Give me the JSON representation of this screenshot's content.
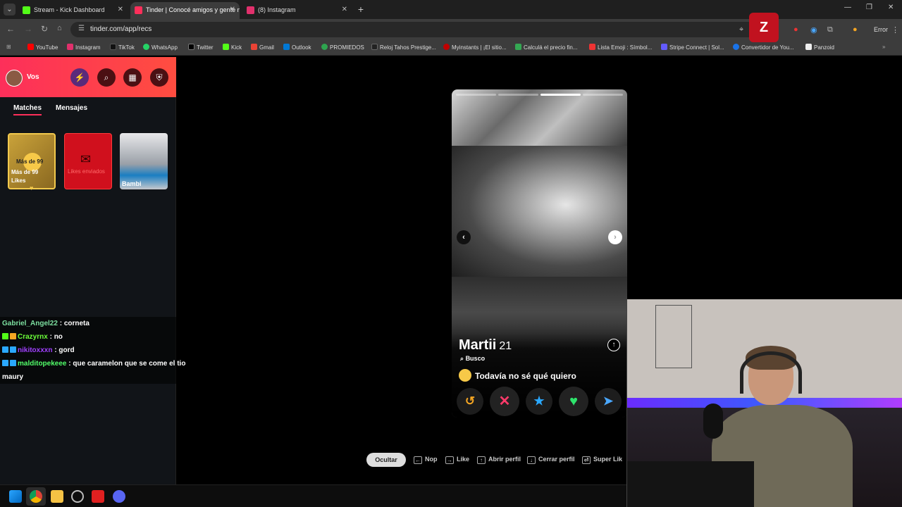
{
  "browser": {
    "tabs": [
      {
        "title": "Stream - Kick Dashboard",
        "active": false,
        "favicon_color": "#53fc18"
      },
      {
        "title": "Tinder | Conocé amigos y gente nueva",
        "active": true,
        "favicon_color": "#fd2f5a"
      },
      {
        "title": "(8) Instagram",
        "active": false,
        "favicon_color": "#e1306c"
      }
    ],
    "url": "tinder.com/app/recs",
    "profile_label": "Error",
    "bookmarks": [
      {
        "label": "YouTube",
        "color": "#ff0000"
      },
      {
        "label": "Instagram",
        "color": "#e1306c"
      },
      {
        "label": "TikTok",
        "color": "#111111"
      },
      {
        "label": "WhatsApp",
        "color": "#25d366"
      },
      {
        "label": "Twitter",
        "color": "#000000"
      },
      {
        "label": "Kick",
        "color": "#53fc18"
      },
      {
        "label": "Gmail",
        "color": "#ea4335"
      },
      {
        "label": "Outlook",
        "color": "#0078d4"
      },
      {
        "label": "PROMIEDOS",
        "color": "#2ea44f"
      },
      {
        "label": "Reloj Tahos Prestige...",
        "color": "#222222"
      },
      {
        "label": "Myinstants | ¡El sitio...",
        "color": "#c00000"
      },
      {
        "label": "Calculá el precio fin...",
        "color": "#34a853"
      },
      {
        "label": "Lista Emoji : Símbol...",
        "color": "#e33"
      },
      {
        "label": "Stripe Connect | Sol...",
        "color": "#635bff"
      },
      {
        "label": "Convertidor de You...",
        "color": "#1a73e8"
      },
      {
        "label": "Panzoid",
        "color": "#eeeeee"
      }
    ]
  },
  "sidebar": {
    "user_label": "Vos",
    "tabs": [
      "Matches",
      "Mensajes"
    ],
    "cards": {
      "likes_bubble": "Más de 99",
      "likes_label": "Más de 99 Likes",
      "sent_label": "Likes enviados",
      "match_name": "Bambi"
    }
  },
  "chat": [
    {
      "user": "Gabriel_Angel22",
      "user_color": "#7de0a0",
      "message": "corneta"
    },
    {
      "user": "Crazyrnx",
      "user_color": "#6cff3a",
      "message": "no"
    },
    {
      "user": "nikitoxxxn",
      "user_color": "#a040ff",
      "message": "gord"
    },
    {
      "user": "malditopekeee",
      "user_color": "#52ff6a",
      "message": "que caramelon que se come el tio maury"
    }
  ],
  "profile": {
    "name": "Martii",
    "age": "21",
    "looking_for_label": "Busco",
    "looking_for_value": "Todavía no sé qué quiero",
    "photo_count": 4,
    "current_photo": 3
  },
  "actions": [
    {
      "name": "rewind",
      "glyph": "↺",
      "color": "#f5a623"
    },
    {
      "name": "nope",
      "glyph": "✕",
      "color": "#ff3a6a"
    },
    {
      "name": "super-like",
      "glyph": "★",
      "color": "#2aa8ff"
    },
    {
      "name": "like",
      "glyph": "♥",
      "color": "#2ee46c"
    },
    {
      "name": "boost",
      "glyph": "➤",
      "color": "#4aa8ff"
    }
  ],
  "hints": {
    "hide_label": "Ocultar",
    "items": [
      {
        "key": "←",
        "label": "Nop"
      },
      {
        "key": "→",
        "label": "Like"
      },
      {
        "key": "↑",
        "label": "Abrir perfil"
      },
      {
        "key": "↓",
        "label": "Cerrar perfil"
      },
      {
        "key": "⏎",
        "label": "Super Lik"
      }
    ]
  }
}
